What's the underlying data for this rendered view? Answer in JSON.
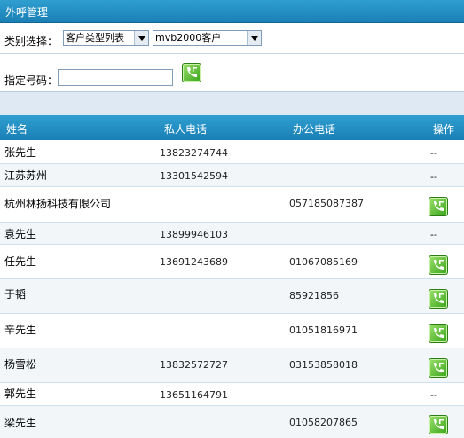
{
  "header": {
    "title": "外呼管理"
  },
  "filter": {
    "label": "类别选择：",
    "type_select": "客户类型列表",
    "customer_select": "mvb2000客户"
  },
  "number": {
    "label": "指定号码：",
    "value": ""
  },
  "columns": {
    "name": "姓名",
    "private": "私人电话",
    "office": "办公电话",
    "action": "操作"
  },
  "rows": [
    {
      "name": "张先生",
      "private": "13823274744",
      "office": "",
      "action": "--"
    },
    {
      "name": "江苏苏州",
      "private": "13301542594",
      "office": "",
      "action": "--"
    },
    {
      "name": "杭州林扬科技有限公司",
      "private": "",
      "office": "057185087387",
      "action": "call-icon"
    },
    {
      "name": "袁先生",
      "private": "13899946103",
      "office": "",
      "action": "--"
    },
    {
      "name": "任先生",
      "private": "13691243689",
      "office": "01067085169",
      "action": "call-icon"
    },
    {
      "name": "于韬",
      "private": "",
      "office": "85921856",
      "action": "call-icon"
    },
    {
      "name": "辛先生",
      "private": "",
      "office": "01051816971",
      "action": "call-icon"
    },
    {
      "name": "杨雪松",
      "private": "13832572727",
      "office": "03153858018",
      "action": "call-icon"
    },
    {
      "name": "郭先生",
      "private": "13651164791",
      "office": "",
      "action": "--"
    },
    {
      "name": "梁先生",
      "private": "",
      "office": "01058207865",
      "action": "call-icon"
    }
  ],
  "colors": {
    "header": "#1a7fb5",
    "band": "#dfe9f3",
    "accent": "#3aa51b"
  }
}
